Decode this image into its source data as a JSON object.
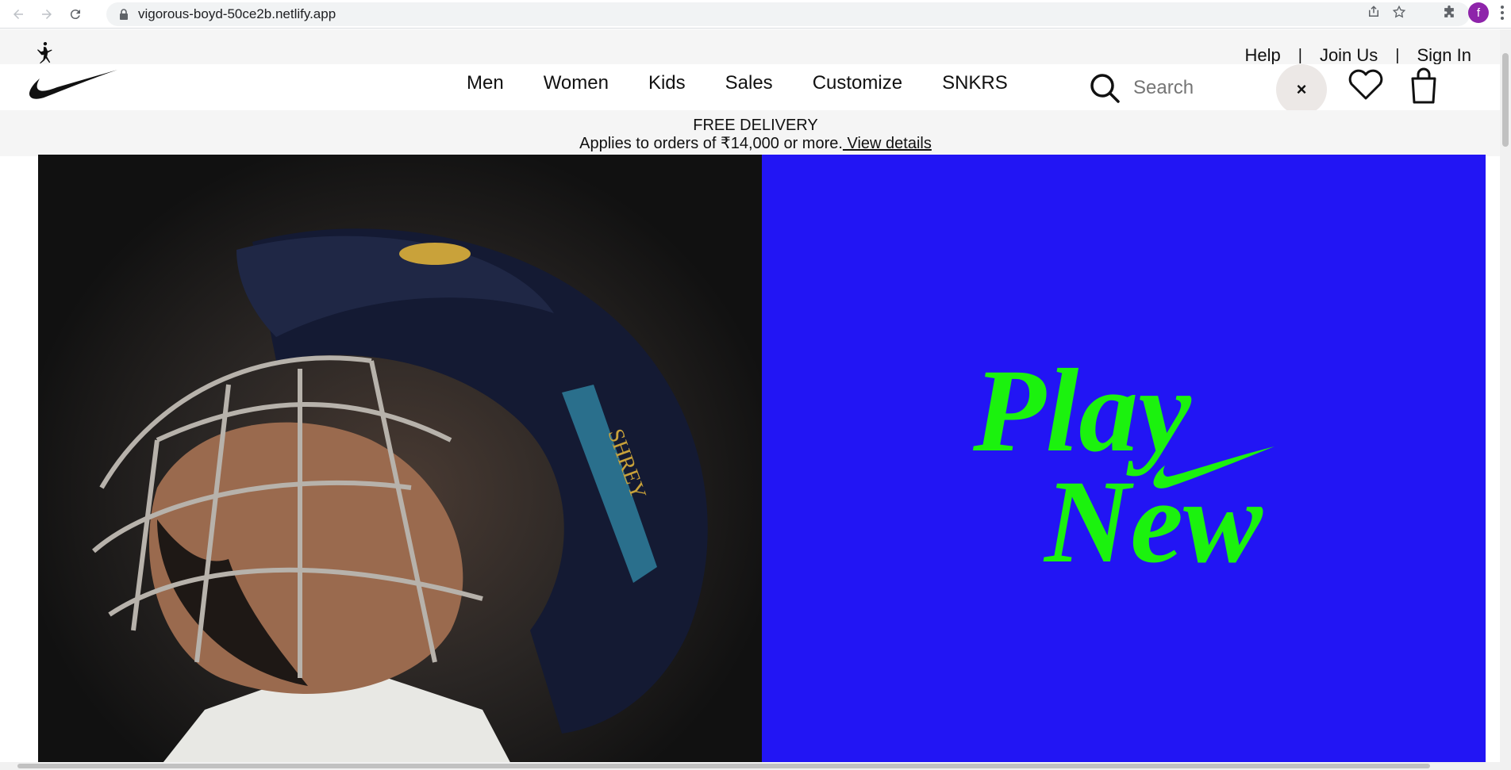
{
  "browser": {
    "url": "vigorous-boyd-50ce2b.netlify.app",
    "avatar_letter": "f"
  },
  "top_links": {
    "help": "Help",
    "sep": "|",
    "join": "Join Us",
    "sign_in": "Sign In"
  },
  "nav": {
    "items": [
      "Men",
      "Women",
      "Kids",
      "Sales",
      "Customize",
      "SNKRS"
    ]
  },
  "search": {
    "placeholder": "Search",
    "close": "×"
  },
  "promo": {
    "title": "FREE DELIVERY",
    "text": "Applies to orders of ₹14,000 or more.",
    "link": " View details"
  },
  "hero": {
    "headline_line1": "Play",
    "headline_line2": "New",
    "helmet_text": "SHREY",
    "colors": {
      "art_bg": "#2215f4",
      "art_text": "#1bf20e"
    }
  }
}
